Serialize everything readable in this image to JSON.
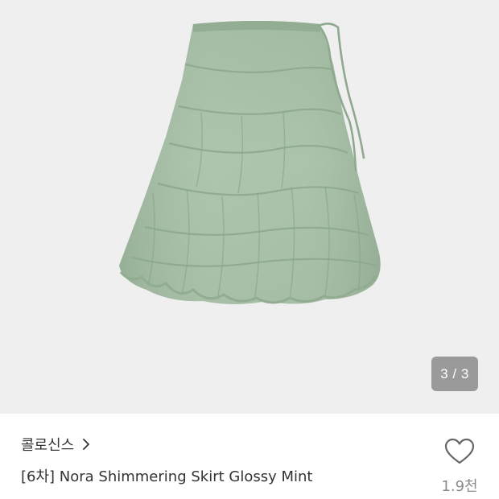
{
  "gallery": {
    "counter_text": "3 / 3",
    "image_alt": "Nora Shimmering Skirt Glossy Mint product photo"
  },
  "product": {
    "brand": "콜로신스",
    "title": "[6차] Nora Shimmering Skirt Glossy Mint"
  },
  "like": {
    "count": "1.9천"
  },
  "colors": {
    "gallery_background": "#efefef",
    "skirt_mint": "#a7bea7",
    "counter_background": "#9a9a9a",
    "text_primary": "#333333",
    "text_secondary": "#8c8c8c"
  },
  "icons": {
    "brand_chevron": "chevron-right-icon",
    "like": "heart-outline-icon"
  }
}
